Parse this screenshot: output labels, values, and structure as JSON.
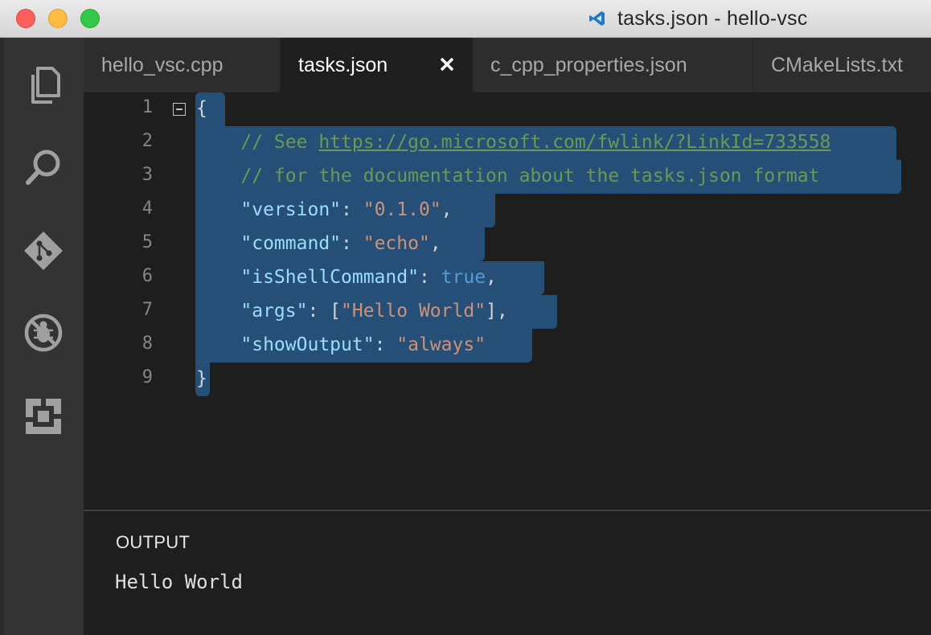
{
  "window": {
    "title": "tasks.json - hello-vsc"
  },
  "activity_bar": {
    "items": [
      {
        "icon": "files-icon"
      },
      {
        "icon": "search-icon"
      },
      {
        "icon": "git-icon"
      },
      {
        "icon": "debug-icon"
      },
      {
        "icon": "extensions-icon"
      }
    ]
  },
  "tabs": [
    {
      "label": "hello_vsc.cpp",
      "active": false
    },
    {
      "label": "tasks.json",
      "active": true
    },
    {
      "label": "c_cpp_properties.json",
      "active": false
    },
    {
      "label": "CMakeLists.txt",
      "active": false
    }
  ],
  "editor": {
    "line_numbers": [
      "1",
      "2",
      "3",
      "4",
      "5",
      "6",
      "7",
      "8",
      "9"
    ],
    "code": {
      "l1_brace": "{",
      "l2_comment": "// See ",
      "l2_link": "https://go.microsoft.com/fwlink/?LinkId=733558",
      "l3_comment": "// for the documentation about the tasks.json format",
      "l4_key": "\"version\"",
      "l4_sep": ": ",
      "l4_val": "\"0.1.0\"",
      "l4_end": ",",
      "l5_key": "\"command\"",
      "l5_sep": ": ",
      "l5_val": "\"echo\"",
      "l5_end": ",",
      "l6_key": "\"isShellCommand\"",
      "l6_sep": ": ",
      "l6_val": "true",
      "l6_end": ",",
      "l7_key": "\"args\"",
      "l7_sep": ": [",
      "l7_val": "\"Hello World\"",
      "l7_end": "],",
      "l8_key": "\"showOutput\"",
      "l8_sep": ": ",
      "l8_val": "\"always\"",
      "l9_brace": "}"
    }
  },
  "panel": {
    "title": "OUTPUT",
    "output": "Hello World"
  },
  "colors": {
    "selection": "#264f78",
    "comment": "#6a9955",
    "key": "#9cdcfe",
    "string": "#ce9178",
    "boolean": "#569cd6"
  }
}
